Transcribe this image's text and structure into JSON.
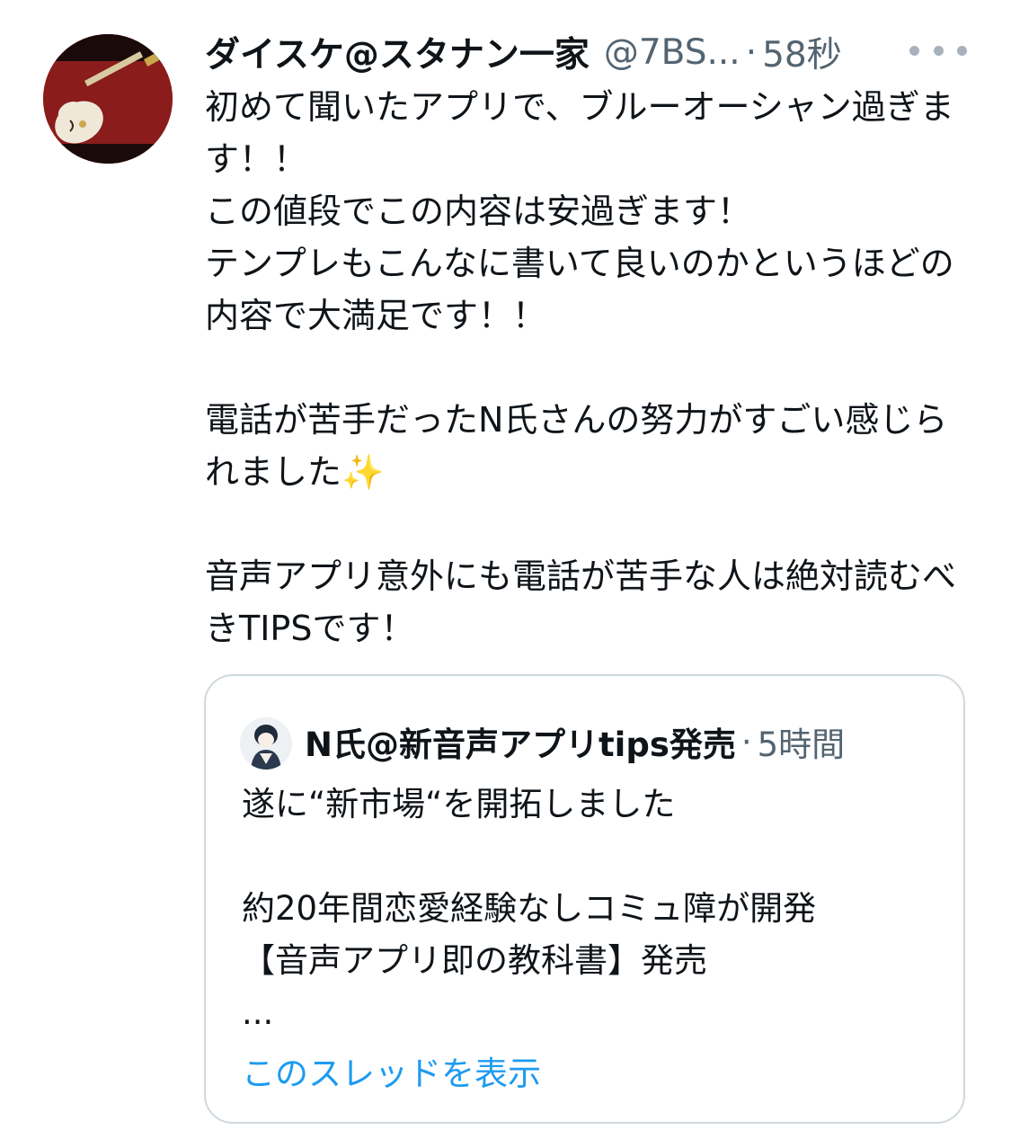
{
  "tweet": {
    "display_name": "ダイスケ@スタナン一家",
    "handle": "@7BS...",
    "separator": "·",
    "time": "58秒",
    "avatar_icon": "guitar-avatar",
    "more_icon": "more-options-icon",
    "paragraphs": [
      "初めて聞いたアプリで、ブルーオーシャン過ぎます！！",
      "この値段でこの内容は安過ぎます！",
      "テンプレもこんなに書いて良いのかというほどの内容で大満足です！！",
      "電話が苦手だったN氏さんの努力がすごい感じられました",
      "音声アプリ意外にも電話が苦手な人は絶対読むべきTIPSです！"
    ],
    "sparkle_emoji": "✨"
  },
  "quoted_tweet": {
    "display_name": "N氏@新音声アプリtips発売",
    "separator": "·",
    "time": "5時間",
    "avatar_icon": "illustrated-person-avatar",
    "lines": [
      "遂に“新市場“を開拓しました",
      "約20年間恋愛経験なしコミュ障が開発",
      "【音声アプリ即の教科書】発売",
      "..."
    ],
    "show_thread_label": "このスレッドを表示"
  },
  "colors": {
    "text_primary": "#0f1419",
    "text_secondary": "#536471",
    "link": "#1d9bf0",
    "border": "#cfd9de"
  }
}
